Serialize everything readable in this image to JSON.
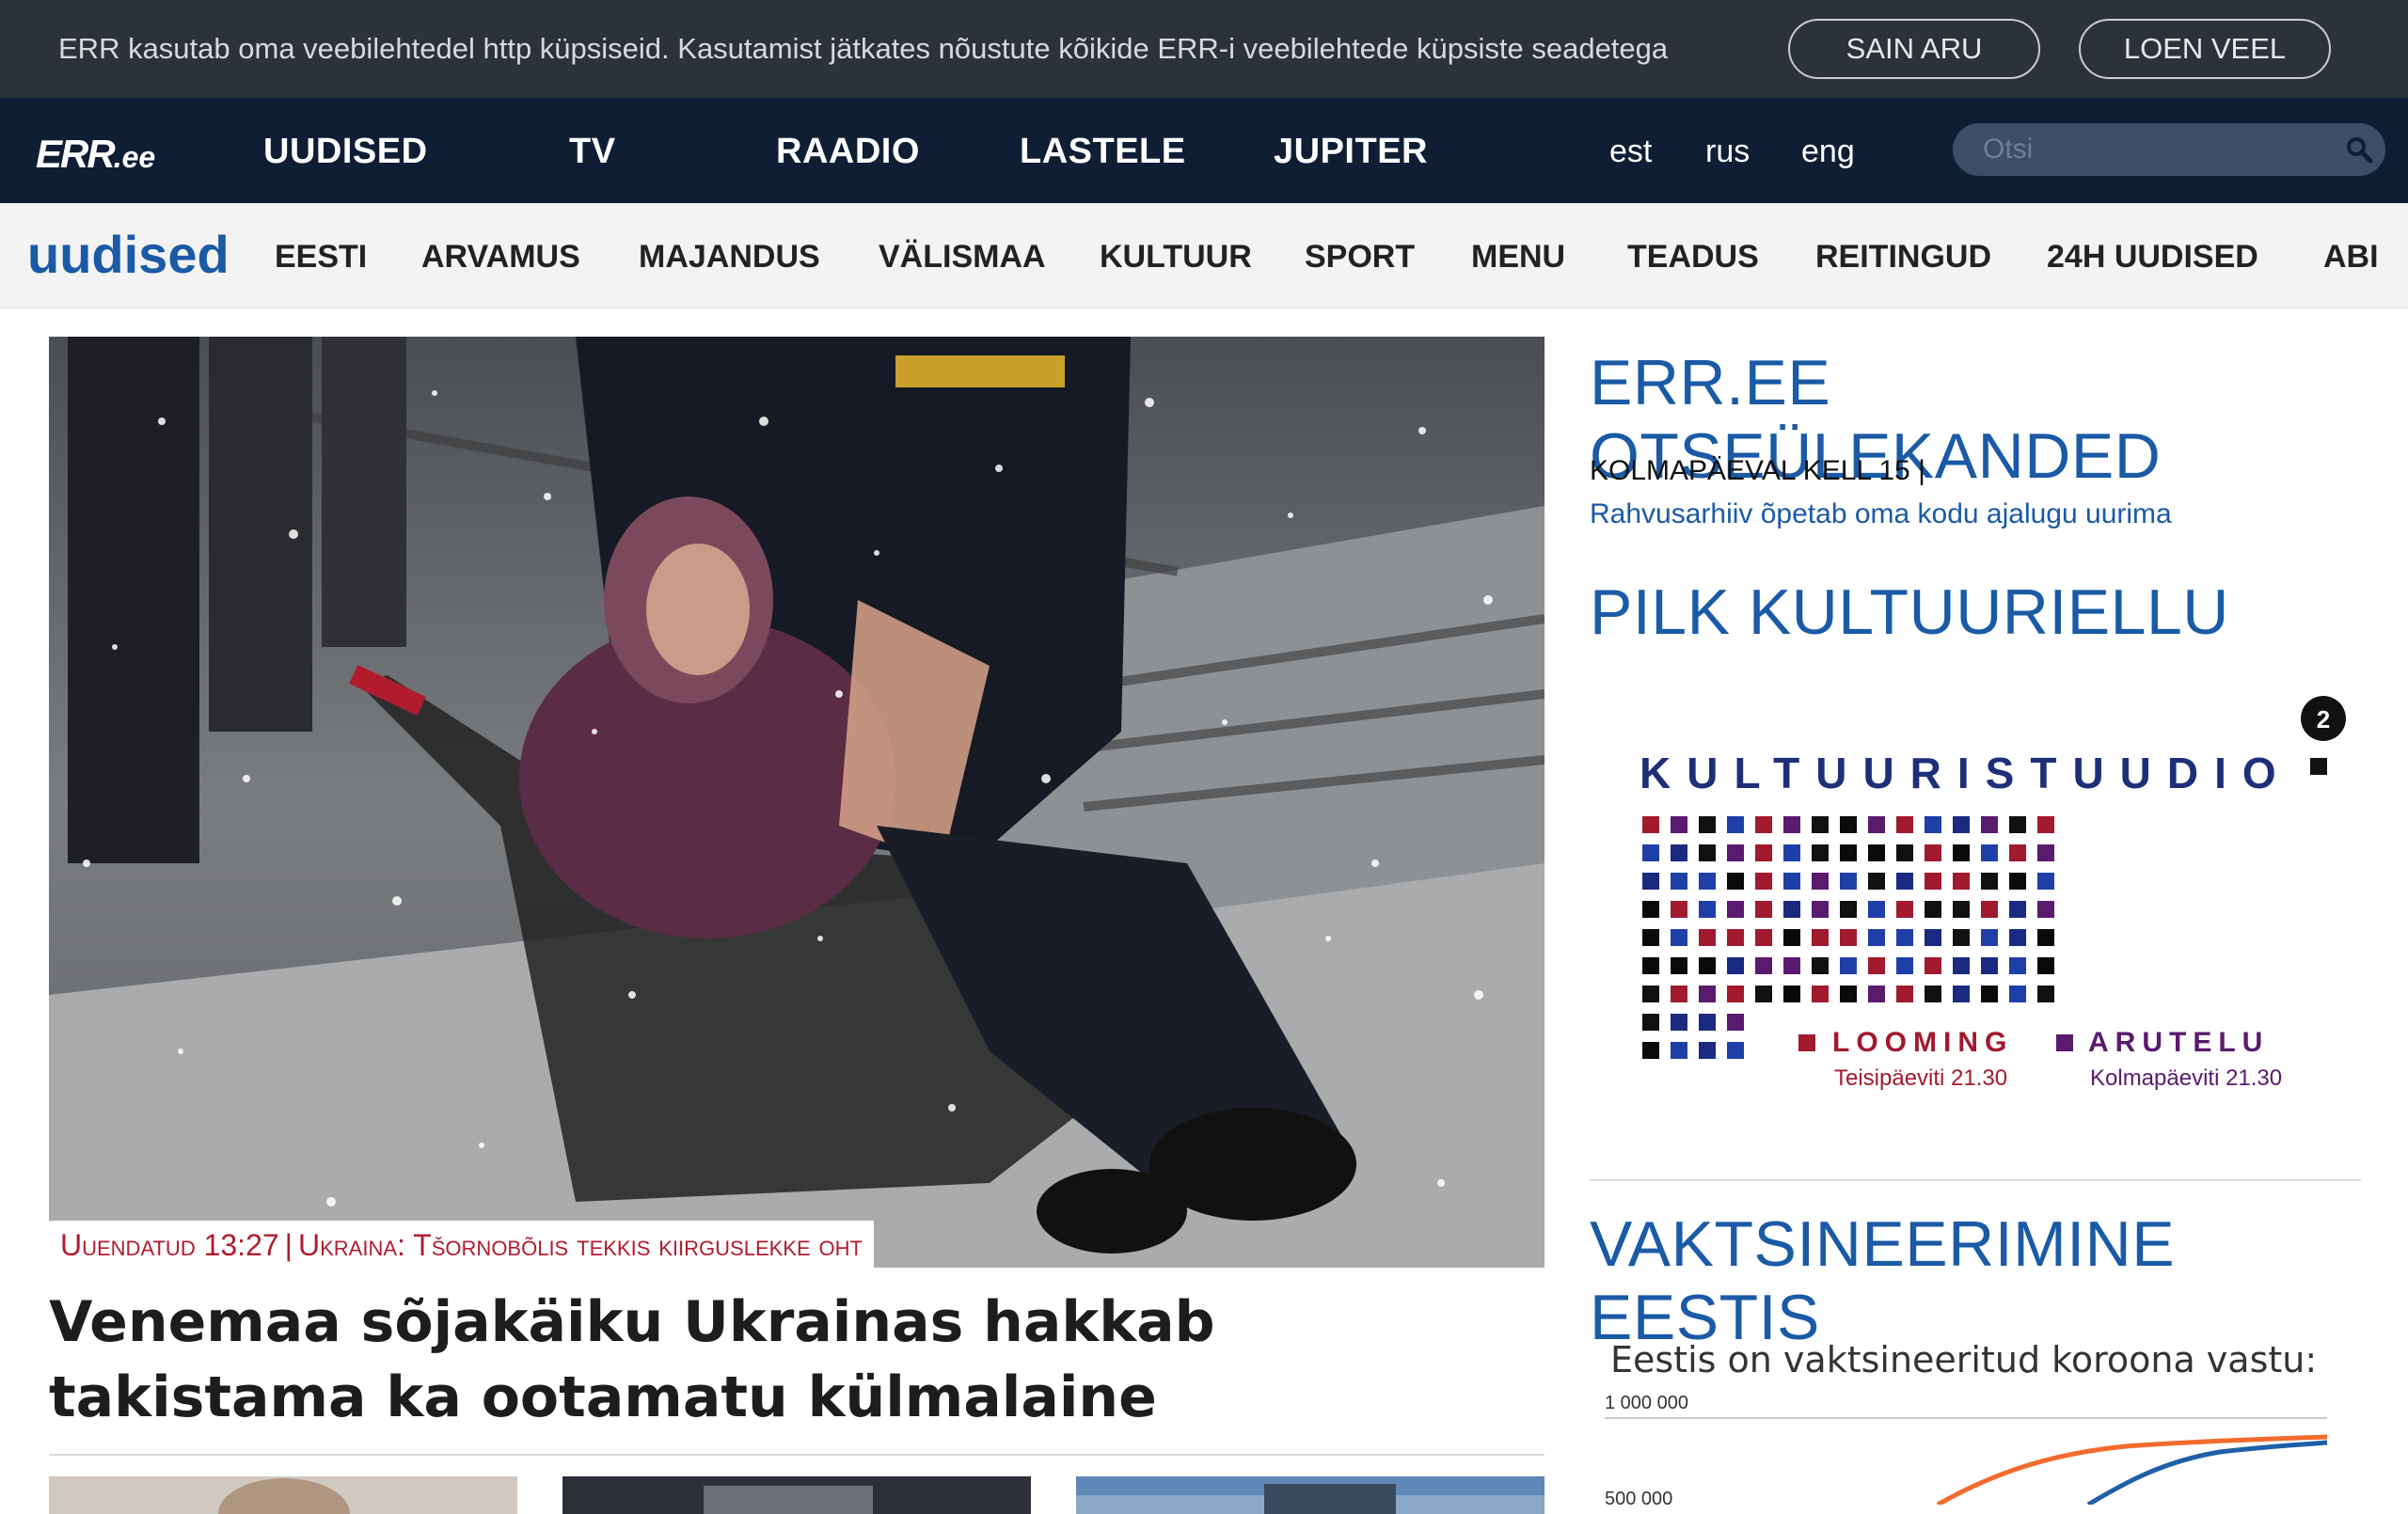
{
  "cookie_bar": {
    "text": "ERR kasutab oma veebilehtedel http küpsiseid. Kasutamist jätkates nõustute kõikide ERR-i veebilehtede küpsiste seadetega",
    "accept_label": "SAIN ARU",
    "more_label": "LOEN VEEL"
  },
  "main_nav": {
    "logo_mark": "ERR",
    "logo_tld": ".ee",
    "links": [
      "UUDISED",
      "TV",
      "RAADIO",
      "LASTELE",
      "JUPITER"
    ],
    "languages": [
      "est",
      "rus",
      "eng"
    ],
    "search_placeholder": "Otsi"
  },
  "sub_nav": {
    "brand": "uudised",
    "links": [
      "EESTI",
      "ARVAMUS",
      "MAJANDUS",
      "VÄLISMAA",
      "KULTUUR",
      "SPORT",
      "MENU",
      "TEADUS",
      "REITINGUD",
      "24H UUDISED",
      "ABI"
    ]
  },
  "hero": {
    "tag_time": "Uuendatud 13:27",
    "tag_separator": "|",
    "tag_topic": "Ukraina: Tšornobõlis tekkis kiirguslekke oht",
    "title": "Venemaa sõjakäiku Ukrainas hakkab takistama ka ootamatu külmalaine"
  },
  "sidebar": {
    "live_heading": "ERR.EE OTSEÜLEKANDED",
    "live_time": "KOLMAPÄEVAL KELL 15 |",
    "live_link": "Rahvusarhiiv õpetab oma kodu ajalugu uurima",
    "culture_heading": "PILK KULTUURIELLU",
    "culture_banner": {
      "channel_logo": "2 etv",
      "title": "KULTUURISTUUDIO",
      "left_label": "LOOMING",
      "left_schedule": "Teisipäeviti 21.30",
      "right_label": "ARUTELU",
      "right_schedule": "Kolmapäeviti 21.30"
    },
    "vaccine_heading": "VAKTSINEERIMINE EESTIS",
    "vaccine_subtitle": "Eestis on vaktsineeritud koroona vastu:",
    "vaccine_tick_top": "1 000 000",
    "vaccine_tick_mid": "500 000"
  },
  "colors": {
    "cookie_bg": "#2b323a",
    "nav_bg": "#0f1e35",
    "subnav_bg": "#f3f3f3",
    "accent_blue": "#1a5aa6",
    "tag_red": "#b01c2e",
    "chart_orange": "#f26b2e",
    "chart_blue": "#1f5fa8"
  }
}
